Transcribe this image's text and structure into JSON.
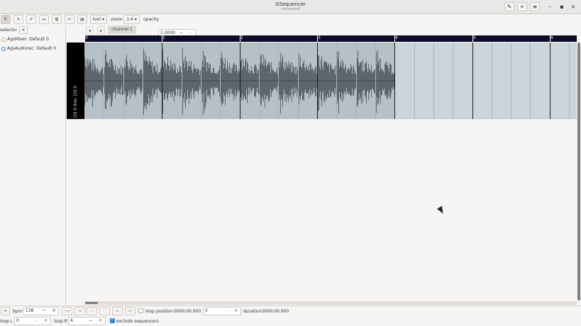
{
  "window": {
    "title": "GSequencer",
    "subtitle": "unnamed",
    "header_buttons": {
      "edit_icon": "✎",
      "add": "+",
      "menu": "≡"
    },
    "window_buttons": {
      "minimize": "–",
      "maximize": "▪",
      "close": "×"
    }
  },
  "toolbar": {
    "position_icon": "⇱",
    "edit_icon": "✎",
    "pen_icon": "✐",
    "move_icon": "↔",
    "copy_icon": "⧉",
    "cut_icon": "✂",
    "paste_icon": "▤",
    "tool_label": "tool",
    "zoom_label": "zoom",
    "zoom_value": "1:4",
    "opacity_label": "opacity",
    "opacity_value": "1.0000",
    "minus": "−",
    "plus": "+"
  },
  "left_panel": {
    "selector_label": "selector",
    "selector_icon": "⌗",
    "machines": [
      {
        "label": "AgsMixer: Default 0",
        "selected": false
      },
      {
        "label": "AgsAudiorec: Default 0",
        "selected": true
      }
    ]
  },
  "editor": {
    "prev": "◂",
    "next": "▸",
    "tab_label": "channel 1",
    "ruler_labels": [
      "0",
      "1",
      "2",
      "3",
      "4",
      "5",
      "6"
    ],
    "track_label": "[0] 0 line: [0] 0"
  },
  "bottom": {
    "bpm_label": "bpm",
    "bpm_value": "138",
    "minus": "−",
    "plus": "+",
    "transport": [
      "|◂◂",
      "◂◂",
      "▷",
      "□",
      "▸▸",
      "▸▸|"
    ],
    "loop_label": "loop",
    "loop_checked": false,
    "position_label": "position",
    "position_value": "0000:00.000",
    "position_entry": "0",
    "duration_label": "duration",
    "duration_value": "0000:00.000",
    "loop_left_label": "loop L",
    "loop_left_value": "0",
    "loop_right_label": "loop R",
    "loop_right_value": "4",
    "exclude_label": "exclude sequencers",
    "exclude_checked": true
  },
  "colors": {
    "ruler_bg": "#0b0b28",
    "lane_bg": "#ccd4db",
    "waveform": "#5d666d",
    "accent": "#3584e4"
  }
}
